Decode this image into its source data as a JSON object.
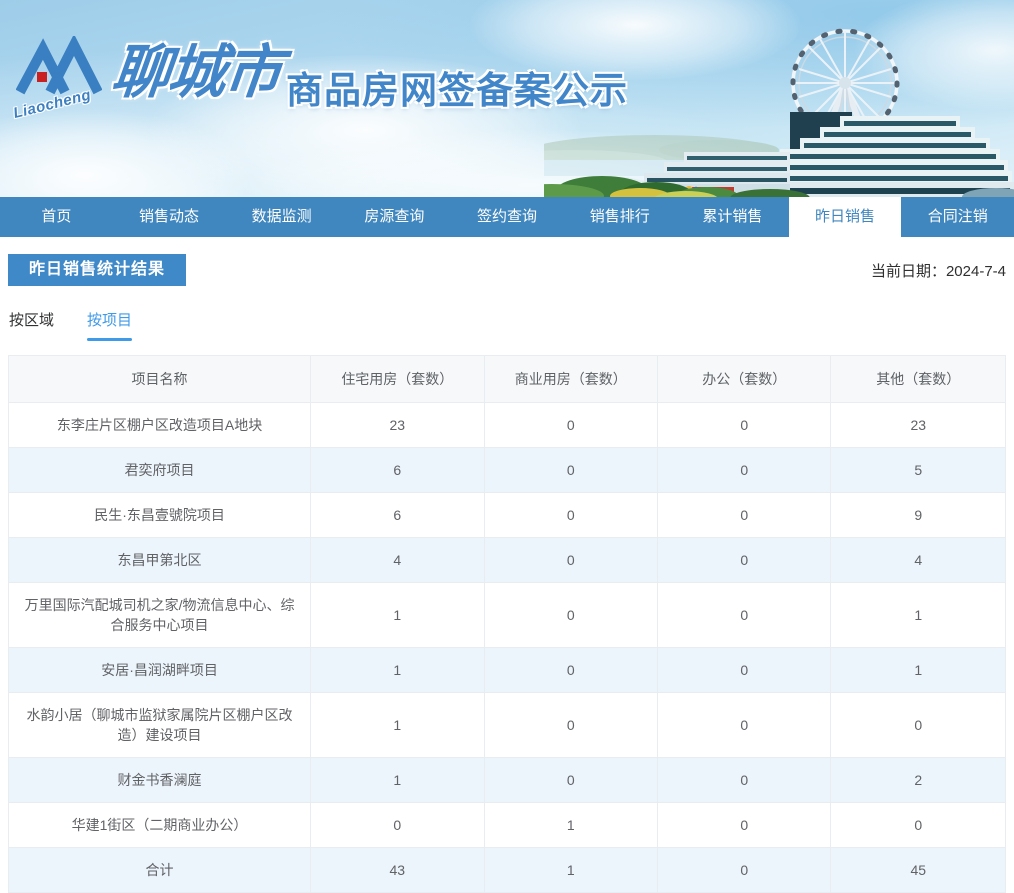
{
  "header": {
    "logo_text": "Liaocheng",
    "brand": "聊城市",
    "subtitle": "商品房网签备案公示"
  },
  "nav": {
    "items": [
      {
        "label": "首页",
        "active": false
      },
      {
        "label": "销售动态",
        "active": false
      },
      {
        "label": "数据监测",
        "active": false
      },
      {
        "label": "房源查询",
        "active": false
      },
      {
        "label": "签约查询",
        "active": false
      },
      {
        "label": "销售排行",
        "active": false
      },
      {
        "label": "累计销售",
        "active": false
      },
      {
        "label": "昨日销售",
        "active": true
      },
      {
        "label": "合同注销",
        "active": false
      }
    ]
  },
  "page": {
    "title": "昨日销售统计结果",
    "date_label": "当前日期：",
    "date_value": "2024-7-4"
  },
  "tabs": [
    {
      "label": "按区域",
      "active": false
    },
    {
      "label": "按项目",
      "active": true
    }
  ],
  "table": {
    "columns": [
      "项目名称",
      "住宅用房（套数）",
      "商业用房（套数）",
      "办公（套数）",
      "其他（套数）"
    ],
    "rows": [
      [
        "东李庄片区棚户区改造项目A地块",
        "23",
        "0",
        "0",
        "23"
      ],
      [
        "君奕府项目",
        "6",
        "0",
        "0",
        "5"
      ],
      [
        "民生·东昌壹號院项目",
        "6",
        "0",
        "0",
        "9"
      ],
      [
        "东昌甲第北区",
        "4",
        "0",
        "0",
        "4"
      ],
      [
        "万里国际汽配城司机之家/物流信息中心、综合服务中心项目",
        "1",
        "0",
        "0",
        "1"
      ],
      [
        "安居·昌润湖畔项目",
        "1",
        "0",
        "0",
        "1"
      ],
      [
        "水韵小居（聊城市监狱家属院片区棚户区改造）建设项目",
        "1",
        "0",
        "0",
        "0"
      ],
      [
        "财金书香澜庭",
        "1",
        "0",
        "0",
        "2"
      ],
      [
        "华建1街区（二期商业办公）",
        "0",
        "1",
        "0",
        "0"
      ],
      [
        "合计",
        "43",
        "1",
        "0",
        "45"
      ]
    ]
  },
  "colors": {
    "nav_blue": "#4187bf",
    "badge_blue": "#4089c8",
    "tab_active_blue": "#3f9ae8",
    "brand_blue": "#4286ca",
    "table_stripe": "#edf5fc",
    "table_border": "#e9edf2",
    "table_header_bg": "#f7f8fa"
  }
}
